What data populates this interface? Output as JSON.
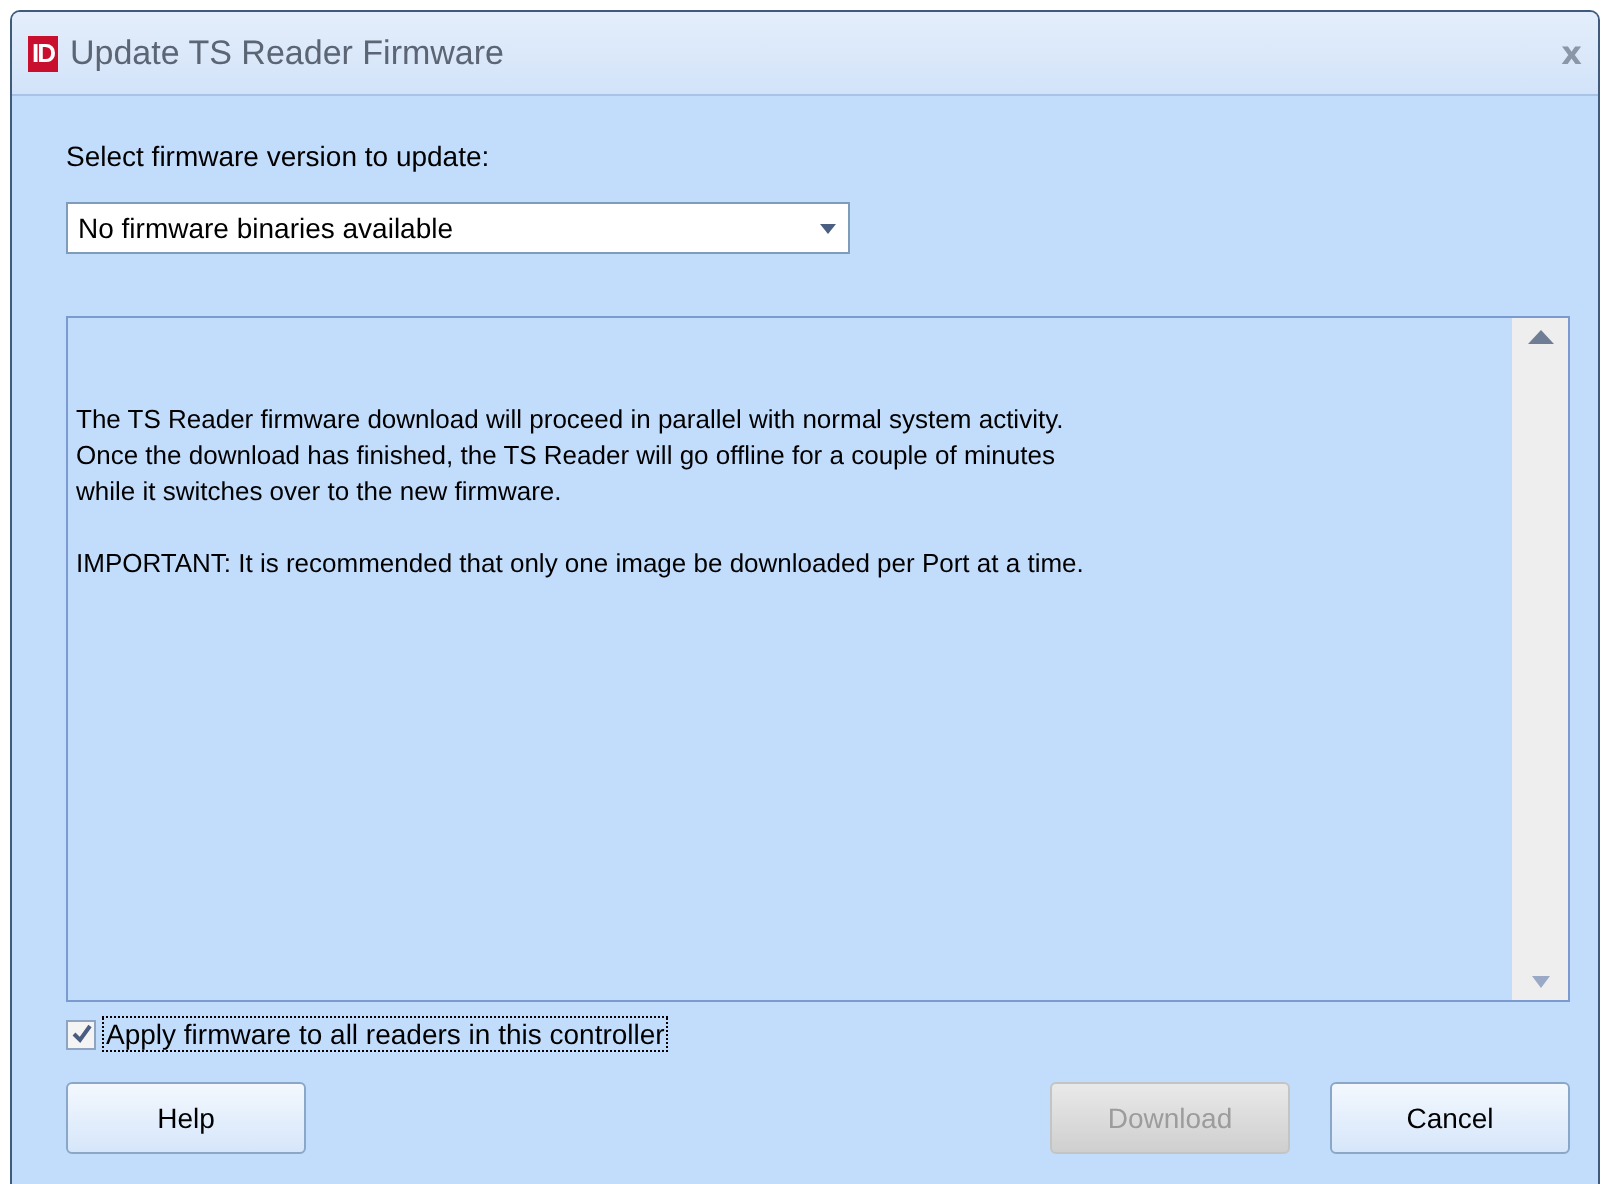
{
  "window": {
    "title": "Update TS Reader Firmware",
    "logo": "ID",
    "close": "x"
  },
  "version_label": "Select firmware version to update:",
  "version_dropdown": {
    "value": "No firmware binaries available"
  },
  "info_text": [
    "The TS Reader firmware download will proceed in parallel with normal system activity.\nOnce the download has finished, the TS Reader will go offline for a couple of minutes\nwhile it switches over to the new firmware.",
    "IMPORTANT: It is recommended that only one image be downloaded per Port at a time."
  ],
  "apply_all": {
    "label": "Apply firmware to all readers in this controller",
    "checked": true
  },
  "buttons": [
    {
      "label": "Help",
      "disabled": false
    },
    {
      "label": "Download",
      "disabled": true
    },
    {
      "label": "Cancel",
      "disabled": false
    }
  ]
}
